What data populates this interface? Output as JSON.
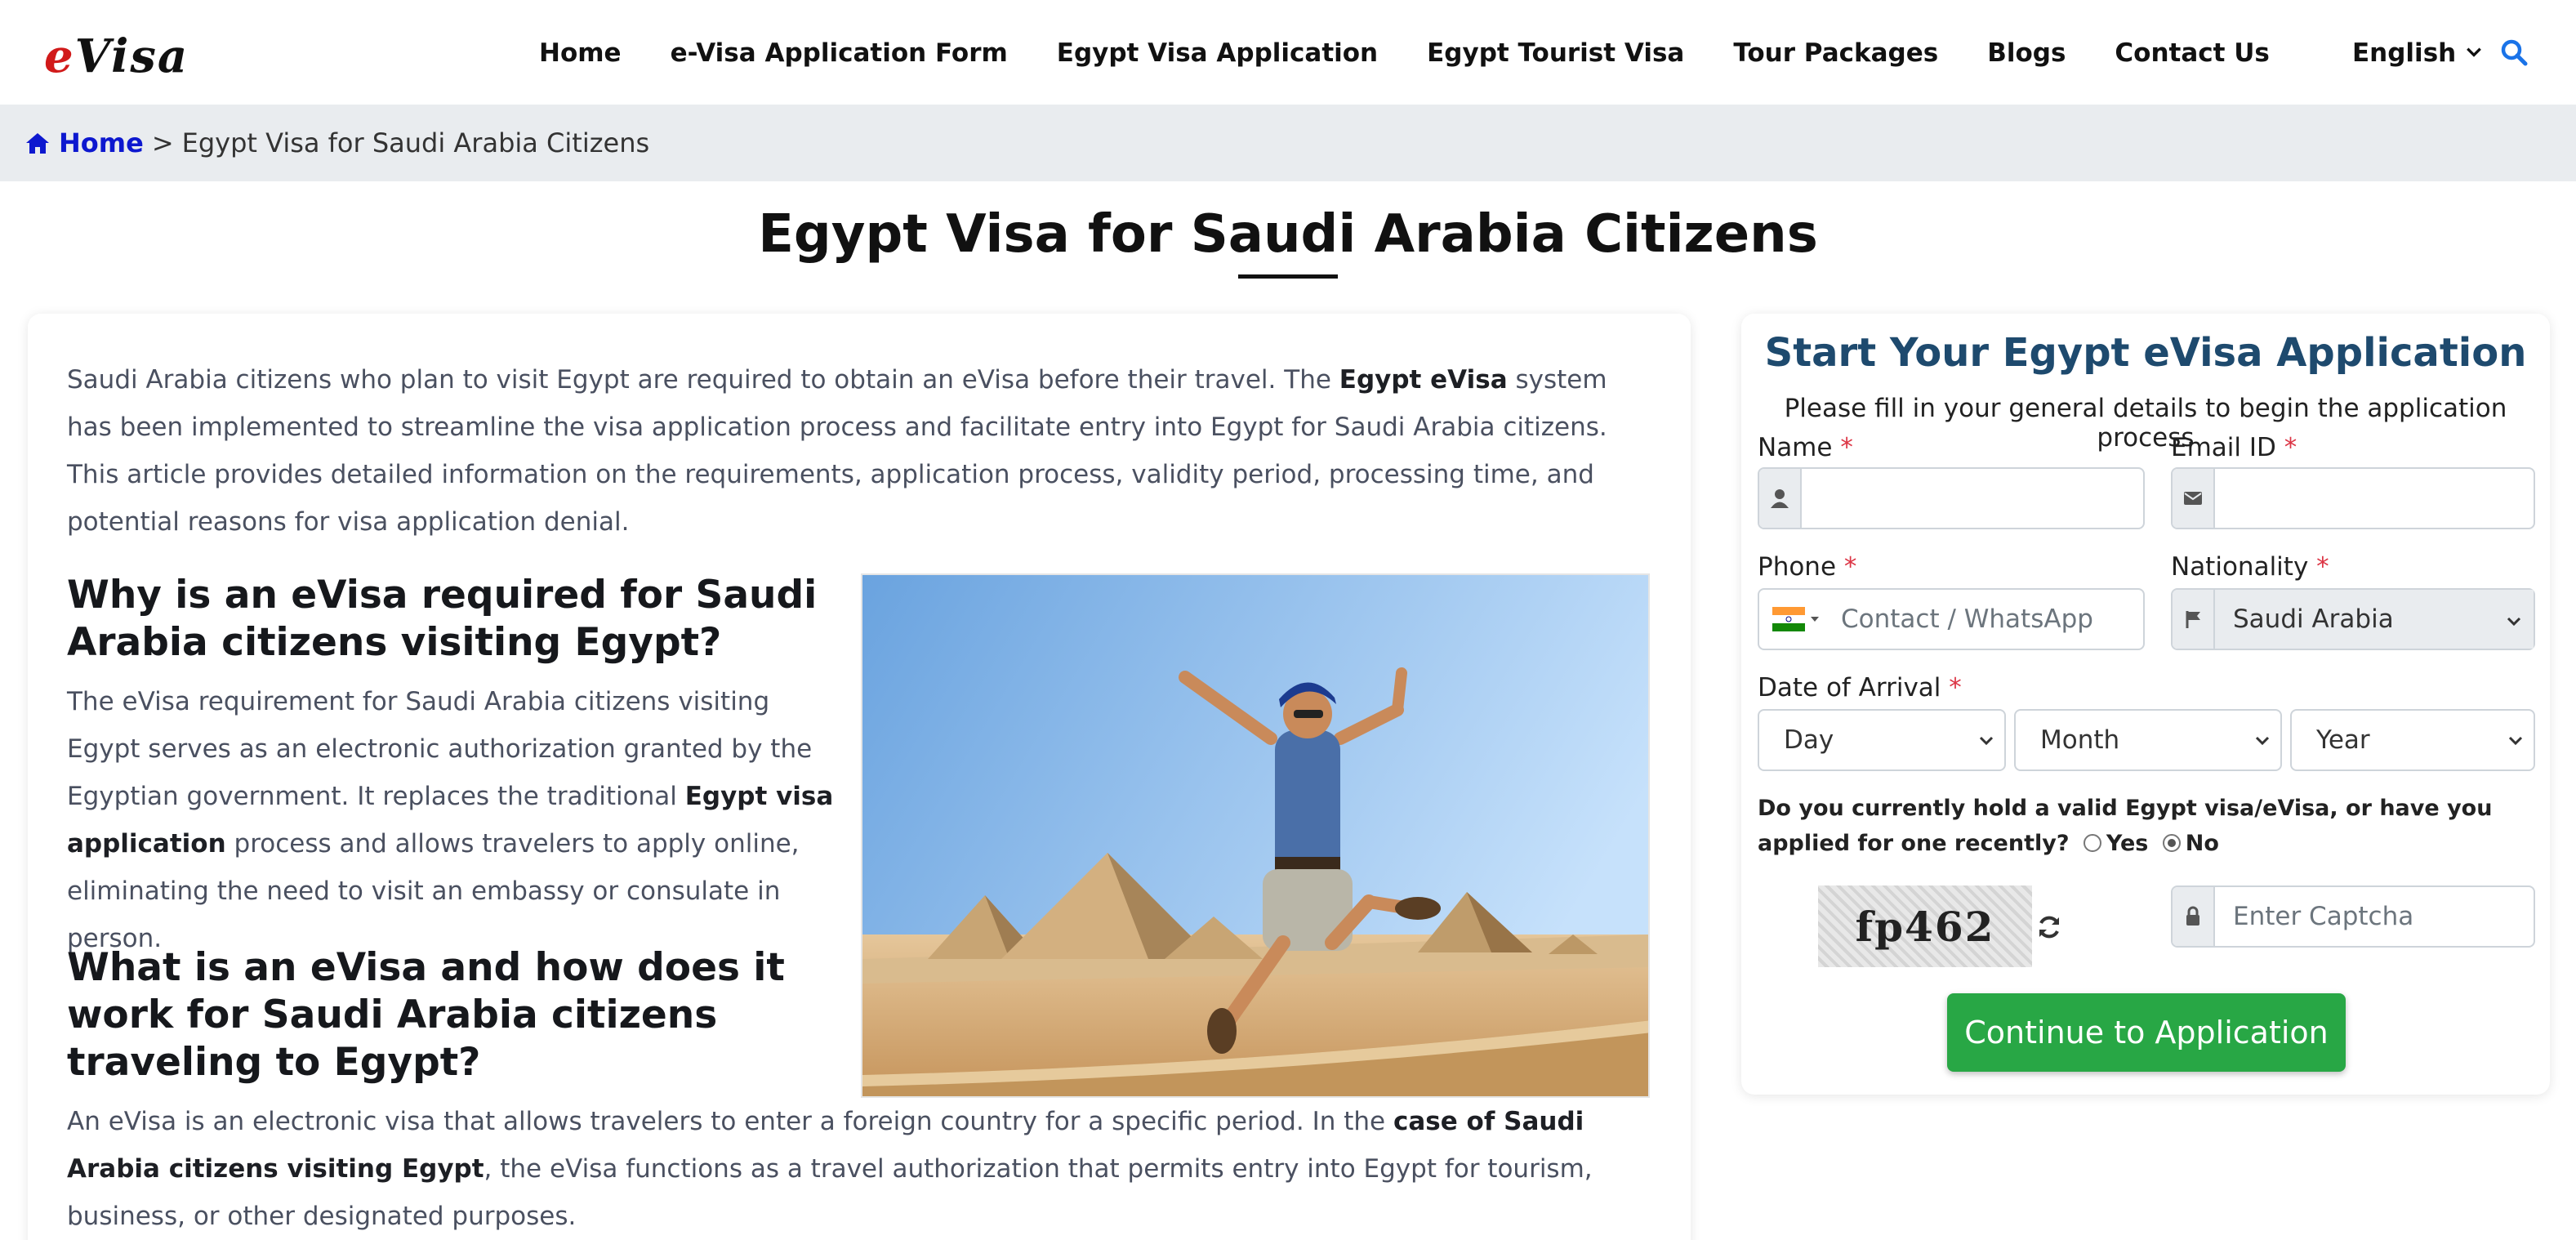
{
  "header": {
    "logo_prefix": "e",
    "logo_main": "Visa",
    "nav": [
      {
        "label": "Home"
      },
      {
        "label": "e-Visa Application Form"
      },
      {
        "label": "Egypt Visa Application"
      },
      {
        "label": "Egypt Tourist Visa"
      },
      {
        "label": "Tour Packages"
      },
      {
        "label": "Blogs"
      },
      {
        "label": "Contact Us"
      }
    ],
    "language": "English",
    "search_icon": "search-icon"
  },
  "breadcrumb": {
    "home": "Home",
    "separator": ">",
    "current": "Egypt Visa for Saudi Arabia Citizens"
  },
  "page_title": "Egypt Visa for Saudi Arabia Citizens",
  "article": {
    "intro_1": "Saudi Arabia citizens who plan to visit Egypt are required to obtain an eVisa before their travel. The ",
    "intro_bold": "Egypt eVisa",
    "intro_2": " system has been implemented to streamline the visa application process and facilitate entry into Egypt for Saudi Arabia citizens. This article provides detailed information on the requirements, application process, validity period, processing time, and potential reasons for visa application denial.",
    "h2_1": "Why is an eVisa required for Saudi Arabia citizens visiting Egypt?",
    "p1_1": "The eVisa requirement for Saudi Arabia citizens visiting Egypt serves as an electronic authorization granted by the Egyptian government. It replaces the traditional ",
    "p1_bold": "Egypt visa application",
    "p1_2": " process and allows travelers to apply online, eliminating the need to visit an embassy or consulate in person.",
    "h2_2": "What is an eVisa and how does it work for Saudi Arabia citizens traveling to Egypt?",
    "p2_1": "An eVisa is an electronic visa that allows travelers to enter a foreign country for a specific period. In the ",
    "p2_bold": "case of Saudi Arabia citizens visiting Egypt",
    "p2_2": ", the eVisa functions as a travel authorization that permits entry into Egypt for tourism, business, or other designated purposes."
  },
  "form": {
    "title": "Start Your Egypt eVisa Application",
    "subtitle": "Please fill in your general details to begin the application process",
    "name_label": "Name",
    "email_label": "Email ID",
    "phone_label": "Phone",
    "phone_placeholder": "Contact / WhatsApp",
    "nationality_label": "Nationality",
    "nationality_value": "Saudi Arabia",
    "arrival_label": "Date of Arrival",
    "day": "Day",
    "month": "Month",
    "year": "Year",
    "required_mark": "*",
    "question": "Do you currently hold a valid Egypt visa/eVisa, or have you applied for one recently?",
    "yes": "Yes",
    "no": "No",
    "selected_answer": "No",
    "captcha_text": "fp462",
    "captcha_placeholder": "Enter Captcha",
    "submit": "Continue to Application"
  },
  "colors": {
    "logo_red": "#d11a1a",
    "breadcrumb_link": "#0d18cf",
    "form_title": "#1e4a6e",
    "submit_green": "#28a745",
    "search_blue": "#1a73e8"
  }
}
